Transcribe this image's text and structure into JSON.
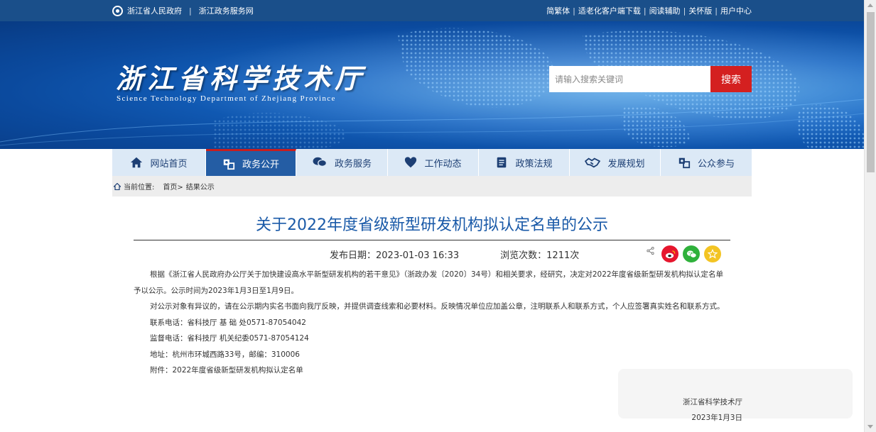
{
  "topbar": {
    "left_links": [
      "浙江省人民政府",
      "浙江政务服务网"
    ],
    "right_links": [
      "简繁体",
      "适老化客户端下载",
      "阅读辅助",
      "关怀版",
      "用户中心"
    ],
    "separator": "|"
  },
  "banner": {
    "logo_text": "浙江省科学技术厅",
    "logo_subtitle": "Science Technology Department of Zhejiang Province"
  },
  "search": {
    "placeholder": "请输入搜索关键词",
    "button_label": "搜索"
  },
  "nav": {
    "items": [
      {
        "label": "网站首页",
        "icon": "home-icon"
      },
      {
        "label": "政务公开",
        "icon": "open-gov-icon",
        "active": true
      },
      {
        "label": "政务服务",
        "icon": "chat-icon"
      },
      {
        "label": "工作动态",
        "icon": "heart-icon"
      },
      {
        "label": "政策法规",
        "icon": "document-icon"
      },
      {
        "label": "发展规划",
        "icon": "handshake-icon"
      },
      {
        "label": "公众参与",
        "icon": "participation-icon"
      }
    ]
  },
  "breadcrumb": {
    "label": "当前位置:",
    "items": [
      "首页>",
      "结果公示"
    ]
  },
  "article": {
    "title": "关于2022年度省级新型研发机构拟认定名单的公示",
    "publish_date": "发布日期：2023-01-03 16:33",
    "views": "浏览次数：1211次",
    "paragraphs": [
      "根据《浙江省人民政府办公厅关于加快建设高水平新型研发机构的若干意见》（浙政办发〔2020〕34号）和相关要求，经研究，决定对2022年度省级新型研发机构拟认定名单予以公示。公示时间为2023年1月3日至1月9日。",
      "对公示对象有异议的，请在公示期内实名书面向我厅反映，并提供调查线索和必要材料。反映情况单位应加盖公章，注明联系人和联系方式，个人应签署真实姓名和联系方式。"
    ],
    "lines": [
      "联系电话：省科技厅 基 础 处0571-87054042",
      "监督电话：省科技厅 机关纪委0571-87054124",
      "地址：杭州市环城西路33号，邮编：310006",
      "附件：2022年度省级新型研发机构拟认定名单"
    ],
    "signer": "浙江省科学技术厅",
    "sign_date": "2023年1月3日"
  },
  "share": {
    "icons": [
      "share-icon",
      "weibo-icon",
      "wechat-icon",
      "favorite-icon"
    ]
  },
  "colors": {
    "topbar": "#1a4f8a",
    "nav_active": "#245da4",
    "nav_bg": "#dce9f6",
    "title": "#1a5aa8",
    "search_button": "#d42020"
  }
}
